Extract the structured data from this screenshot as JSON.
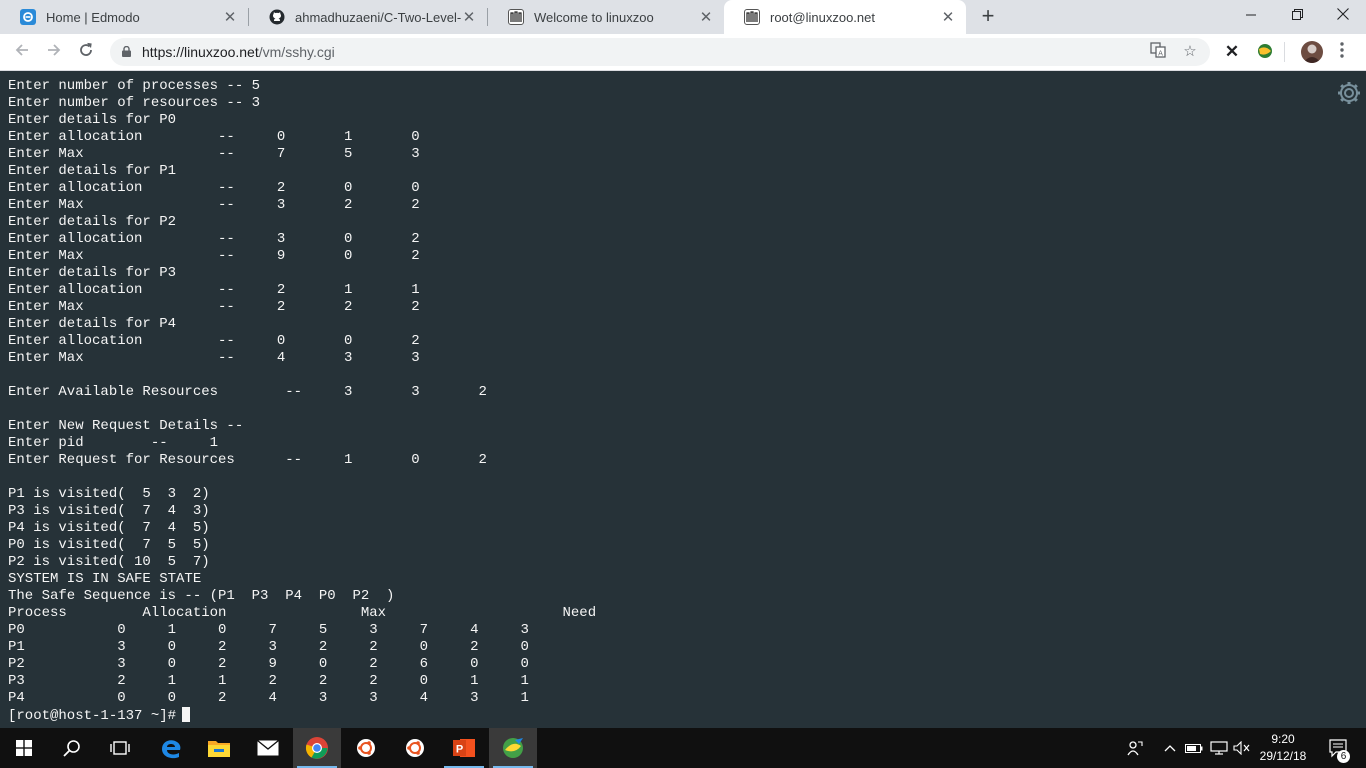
{
  "browser": {
    "tabs": [
      {
        "title": "Home | Edmodo",
        "icon": "edmodo-icon"
      },
      {
        "title": "ahmadhuzaeni/C-Two-Level-Dire",
        "icon": "github-icon"
      },
      {
        "title": "Welcome to linuxzoo",
        "icon": "linuxzoo-icon"
      },
      {
        "title": "root@linuxzoo.net",
        "icon": "linuxzoo-icon",
        "active": true
      }
    ],
    "new_tab": "+",
    "url_host": "https://linuxzoo.net",
    "url_path": "/vm/sshy.cgi"
  },
  "terminal": {
    "lines": [
      "Enter number of processes -- 5",
      "Enter number of resources -- 3",
      "Enter details for P0",
      "Enter allocation         --     0       1       0",
      "Enter Max                --     7       5       3",
      "Enter details for P1",
      "Enter allocation         --     2       0       0",
      "Enter Max                --     3       2       2",
      "Enter details for P2",
      "Enter allocation         --     3       0       2",
      "Enter Max                --     9       0       2",
      "Enter details for P3",
      "Enter allocation         --     2       1       1",
      "Enter Max                --     2       2       2",
      "Enter details for P4",
      "Enter allocation         --     0       0       2",
      "Enter Max                --     4       3       3",
      "",
      "Enter Available Resources        --     3       3       2",
      "",
      "Enter New Request Details --",
      "Enter pid        --     1",
      "Enter Request for Resources      --     1       0       2",
      "",
      "P1 is visited(  5  3  2)",
      "P3 is visited(  7  4  3)",
      "P4 is visited(  7  4  5)",
      "P0 is visited(  7  5  5)",
      "P2 is visited( 10  5  7)",
      "SYSTEM IS IN SAFE STATE",
      "The Safe Sequence is -- (P1  P3  P4  P0  P2  )",
      "Process         Allocation                Max                     Need",
      "P0           0     1     0     7     5     3     7     4     3",
      "P1           3     0     2     3     2     2     0     2     0",
      "P2           3     0     2     9     0     2     6     0     0",
      "P3           2     1     1     2     2     2     0     1     1",
      "P4           0     0     2     4     3     3     4     3     1"
    ],
    "prompt": "[root@host-1-137 ~]#"
  },
  "taskbar": {
    "time": "9:20",
    "date": "29/12/18",
    "notification_count": "6"
  },
  "colors": {
    "terminal_bg": "#263238",
    "terminal_fg": "#f5f5f5",
    "tabbar_bg": "#dee1e6",
    "taskbar_bg": "#101010"
  }
}
